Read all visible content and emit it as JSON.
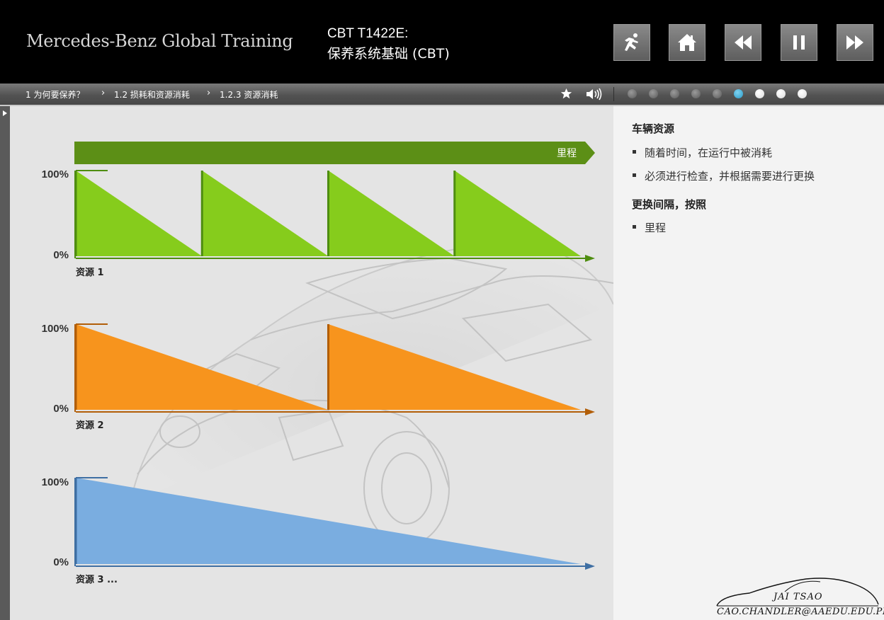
{
  "header": {
    "brand": "Mercedes-Benz Global Training",
    "course_code": "CBT T1422E:",
    "course_title": "保养系统基础 (CBT)",
    "controls": [
      {
        "name": "exit-button",
        "icon": "running-man-icon"
      },
      {
        "name": "home-button",
        "icon": "house-icon"
      },
      {
        "name": "previous-button",
        "icon": "rewind-icon"
      },
      {
        "name": "pause-button",
        "icon": "pause-icon"
      },
      {
        "name": "next-button",
        "icon": "fast-forward-icon"
      }
    ]
  },
  "breadcrumb": {
    "items": [
      "1 为何要保养？",
      "1.2 损耗和资源消耗",
      "1.2.3 资源消耗"
    ],
    "separator": "›"
  },
  "nav_icons": [
    "star-icon",
    "speaker-icon"
  ],
  "pagination": {
    "total": 9,
    "current": 6
  },
  "chart_data": {
    "type": "area",
    "xlabel": "里程",
    "ytick_labels": [
      "100%",
      "0%"
    ],
    "ylim": [
      0,
      100
    ],
    "series": [
      {
        "name": "资源 1",
        "color": "#86cc1c",
        "edge_color": "#4e8d10",
        "replacements": 4,
        "x": [
          0,
          1,
          1,
          2,
          2,
          3,
          3,
          4
        ],
        "y": [
          100,
          0,
          100,
          0,
          100,
          0,
          100,
          0
        ]
      },
      {
        "name": "资源 2",
        "color": "#f7941d",
        "edge_color": "#b25e08",
        "replacements": 2,
        "x": [
          0,
          2,
          2,
          4
        ],
        "y": [
          100,
          0,
          100,
          0
        ]
      },
      {
        "name": "资源 3 ...",
        "color": "#7aade0",
        "edge_color": "#3f6fa3",
        "replacements": 1,
        "x": [
          0,
          4
        ],
        "y": [
          100,
          0
        ]
      }
    ],
    "mileage_arrow_color": "#5c8f16"
  },
  "panel": {
    "section1_title": "车辆资源",
    "section1_bullets": [
      "随着时间，在运行中被消耗",
      "必须进行检查，并根据需要进行更换"
    ],
    "section2_title": "更换间隔，按照",
    "section2_bullets": [
      "里程"
    ]
  },
  "watermark": {
    "name": "JAI TSAO",
    "email": "CAO.CHANDLER@AAEDU.EDU.PL"
  }
}
